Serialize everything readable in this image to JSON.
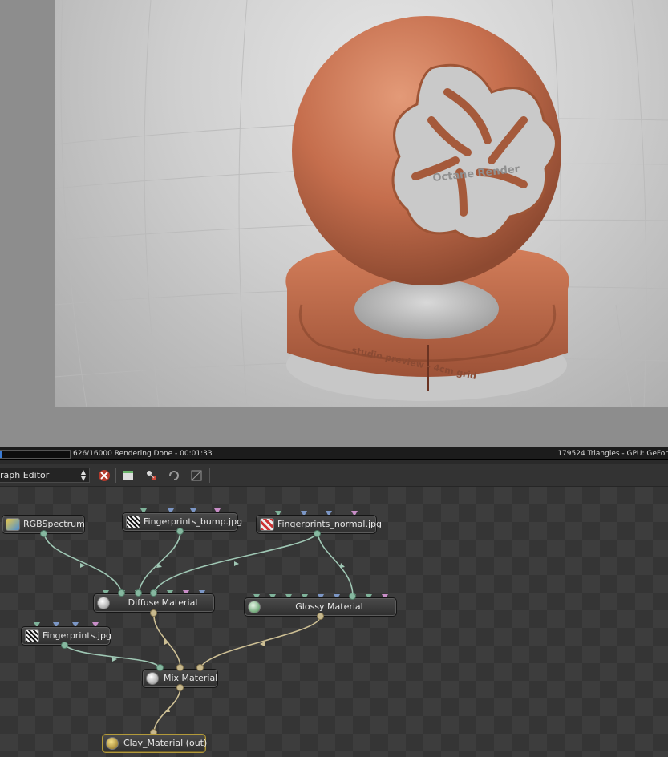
{
  "render_view": {
    "sphere_text": "Octane Render",
    "base_text": "studio preview - 4cm grid"
  },
  "status": {
    "progress": 0.04,
    "left_text": "626/16000 Rendering Done - 00:01:33",
    "right_text": "179524 Triangles - GPU: GeFor"
  },
  "toolbar": {
    "editor_select": "raph Editor",
    "icons": [
      "delete-icon",
      "clapboard-icon",
      "nodes-icon",
      "refresh-icon",
      "graph-icon"
    ]
  },
  "nodes": {
    "rgbspectrum": "RGBSpectrum",
    "fingerprints_bump": "Fingerprints_bump.jpg",
    "fingerprints_normal": "Fingerprints_normal.jpg",
    "diffuse": "Diffuse Material",
    "glossy": "Glossy Material",
    "fingerprints": "Fingerprints.jpg",
    "mix": "Mix Material",
    "clay_out": "Clay_Material (out)"
  },
  "colors": {
    "wire_texture": "#9fc7b4",
    "wire_material": "#cdbf94",
    "pin_green": "#7fb39a",
    "pin_blue": "#7c97c6",
    "pin_pink": "#c98ec8",
    "out_border": "#b39a3a"
  }
}
